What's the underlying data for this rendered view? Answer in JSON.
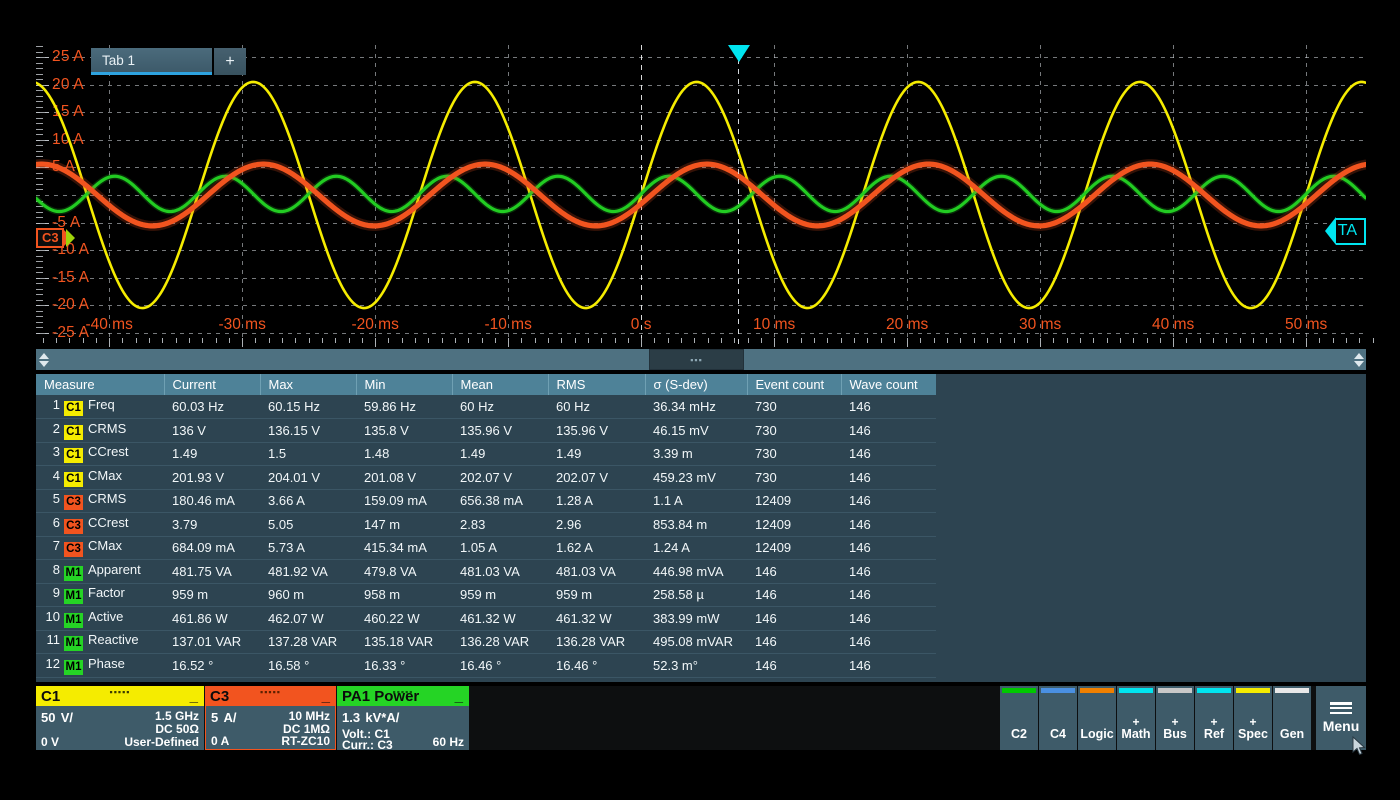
{
  "tabs": {
    "items": [
      {
        "label": "Tab 1"
      }
    ],
    "add_label": "+"
  },
  "scope": {
    "y_axis": {
      "unit": "A",
      "labels": [
        "25 A",
        "20 A",
        "15 A",
        "10 A",
        "5 A",
        "-5 A",
        "-10 A",
        "-15 A",
        "-20 A",
        "-25 A"
      ],
      "values": [
        25,
        20,
        15,
        10,
        5,
        -5,
        -10,
        -15,
        -20,
        -25
      ],
      "color": "#f2541f"
    },
    "x_axis": {
      "labels": [
        "-40 ms",
        "-30 ms",
        "-20 ms",
        "-10 ms",
        "0 s",
        "10 ms",
        "20 ms",
        "30 ms",
        "40 ms",
        "50 ms"
      ],
      "values_ms": [
        -40,
        -30,
        -20,
        -10,
        0,
        10,
        20,
        30,
        40,
        50
      ],
      "color": "#f2541f"
    },
    "markers": {
      "channel_marker": "C3",
      "right_marker": "TA",
      "trigger_icon": "trigger-arrow-icon"
    }
  },
  "chart_data": {
    "type": "line",
    "title": "",
    "xlabel": "",
    "ylabel": "A",
    "xlim": [
      -45,
      55
    ],
    "ylim": [
      -27,
      27
    ],
    "grid": true,
    "legend": "none",
    "series": [
      {
        "name": "C1",
        "color": "#f5ec00",
        "amplitude": 20.5,
        "frequency_hz": 60,
        "phase_deg": 0,
        "offset": 0
      },
      {
        "name": "C3",
        "color": "#f2541f",
        "amplitude": 5.6,
        "frequency_hz": 60,
        "phase_deg": -16.5,
        "offset": 0
      },
      {
        "name": "M1",
        "color": "#22cc22",
        "amplitude": 3.2,
        "frequency_hz": 120,
        "phase_deg": 0,
        "offset": 0.2
      }
    ]
  },
  "scrollbar": {
    "thumb_glyph": "▪▪▪",
    "left_arrows": "up-down-arrows",
    "right_arrows": "up-down-arrows"
  },
  "measurements": {
    "columns": [
      "Measure",
      "Current",
      "Max",
      "Min",
      "Mean",
      "RMS",
      "σ (S-dev)",
      "Event count",
      "Wave count"
    ],
    "rows": [
      {
        "index": "1",
        "source": "C1",
        "name": "Freq",
        "current": "60.03 Hz",
        "max": "60.15 Hz",
        "min": "59.86 Hz",
        "mean": "60 Hz",
        "rms": "60 Hz",
        "sdev": "36.34 mHz",
        "events": "730",
        "waves": "146"
      },
      {
        "index": "2",
        "source": "C1",
        "name": "CRMS",
        "current": "136 V",
        "max": "136.15 V",
        "min": "135.8 V",
        "mean": "135.96 V",
        "rms": "135.96 V",
        "sdev": "46.15 mV",
        "events": "730",
        "waves": "146"
      },
      {
        "index": "3",
        "source": "C1",
        "name": "CCrest",
        "current": "1.49",
        "max": "1.5",
        "min": "1.48",
        "mean": "1.49",
        "rms": "1.49",
        "sdev": "3.39 m",
        "events": "730",
        "waves": "146"
      },
      {
        "index": "4",
        "source": "C1",
        "name": "CMax",
        "current": "201.93 V",
        "max": "204.01 V",
        "min": "201.08 V",
        "mean": "202.07 V",
        "rms": "202.07 V",
        "sdev": "459.23 mV",
        "events": "730",
        "waves": "146"
      },
      {
        "index": "5",
        "source": "C3",
        "name": "CRMS",
        "current": "180.46 mA",
        "max": "3.66 A",
        "min": "159.09 mA",
        "mean": "656.38 mA",
        "rms": "1.28 A",
        "sdev": "1.1 A",
        "events": "12409",
        "waves": "146"
      },
      {
        "index": "6",
        "source": "C3",
        "name": "CCrest",
        "current": "3.79",
        "max": "5.05",
        "min": "147 m",
        "mean": "2.83",
        "rms": "2.96",
        "sdev": "853.84 m",
        "events": "12409",
        "waves": "146"
      },
      {
        "index": "7",
        "source": "C3",
        "name": "CMax",
        "current": "684.09 mA",
        "max": "5.73 A",
        "min": "415.34 mA",
        "mean": "1.05 A",
        "rms": "1.62 A",
        "sdev": "1.24 A",
        "events": "12409",
        "waves": "146"
      },
      {
        "index": "8",
        "source": "M1",
        "name": "Apparent",
        "current": "481.75 VA",
        "max": "481.92 VA",
        "min": "479.8 VA",
        "mean": "481.03 VA",
        "rms": "481.03 VA",
        "sdev": "446.98 mVA",
        "events": "146",
        "waves": "146"
      },
      {
        "index": "9",
        "source": "M1",
        "name": "Factor",
        "current": "959 m",
        "max": "960 m",
        "min": "958 m",
        "mean": "959 m",
        "rms": "959 m",
        "sdev": "258.58 µ",
        "events": "146",
        "waves": "146"
      },
      {
        "index": "10",
        "source": "M1",
        "name": "Active",
        "current": "461.86 W",
        "max": "462.07 W",
        "min": "460.22 W",
        "mean": "461.32 W",
        "rms": "461.32 W",
        "sdev": "383.99 mW",
        "events": "146",
        "waves": "146"
      },
      {
        "index": "11",
        "source": "M1",
        "name": "Reactive",
        "current": "137.01 VAR",
        "max": "137.28 VAR",
        "min": "135.18 VAR",
        "mean": "136.28 VAR",
        "rms": "136.28 VAR",
        "sdev": "495.08 mVAR",
        "events": "146",
        "waves": "146"
      },
      {
        "index": "12",
        "source": "M1",
        "name": "Phase",
        "current": "16.52 °",
        "max": "16.58 °",
        "min": "16.33 °",
        "mean": "16.46 °",
        "rms": "16.46 °",
        "sdev": "52.3 m°",
        "events": "146",
        "waves": "146"
      }
    ],
    "badge_colors": {
      "C1": "#f5ec00",
      "C3": "#f2541f",
      "M1": "#25d425"
    }
  },
  "channels": [
    {
      "id": "C1",
      "title": "C1",
      "header_color": "#f5ec00",
      "minimize": "_",
      "scale": "50",
      "scale_unit": "V/",
      "right_top": "1.5 GHz",
      "right_mid": "DC 50Ω",
      "bottom_left": "0 V",
      "bottom_right": "User-Defined"
    },
    {
      "id": "C3",
      "title": "C3",
      "header_color": "#f2541f",
      "minimize": "_",
      "scale": "5",
      "scale_unit": "A/",
      "right_top": "10 MHz",
      "right_mid": "DC 1MΩ",
      "bottom_left": "0 A",
      "bottom_right": "RT-ZC10"
    }
  ],
  "power_card": {
    "title": "PA1 Power",
    "header_color": "#25d425",
    "minimize": "_",
    "scale": "1.3",
    "scale_unit": "kV*A/",
    "line1": "Volt.: C1",
    "line2": "Curr.: C3",
    "freq": "60 Hz"
  },
  "right_buttons": [
    {
      "label": "C2",
      "cap_color": "#00c800",
      "plus": false
    },
    {
      "label": "C4",
      "cap_color": "#4a90e2",
      "plus": false
    },
    {
      "label": "Logic",
      "cap_color": "#f08000",
      "plus": false
    },
    {
      "label": "Math",
      "cap_color": "#00e5f0",
      "plus": true
    },
    {
      "label": "Bus",
      "cap_color": "#c8c8c8",
      "plus": true
    },
    {
      "label": "Ref",
      "cap_color": "#00e5f0",
      "plus": true
    },
    {
      "label": "Spec",
      "cap_color": "#f5ec00",
      "plus": true
    },
    {
      "label": "Gen",
      "cap_color": "#e8e8e8",
      "plus": false
    }
  ],
  "menu_button": {
    "label": "Menu",
    "icon": "hamburger-icon"
  }
}
